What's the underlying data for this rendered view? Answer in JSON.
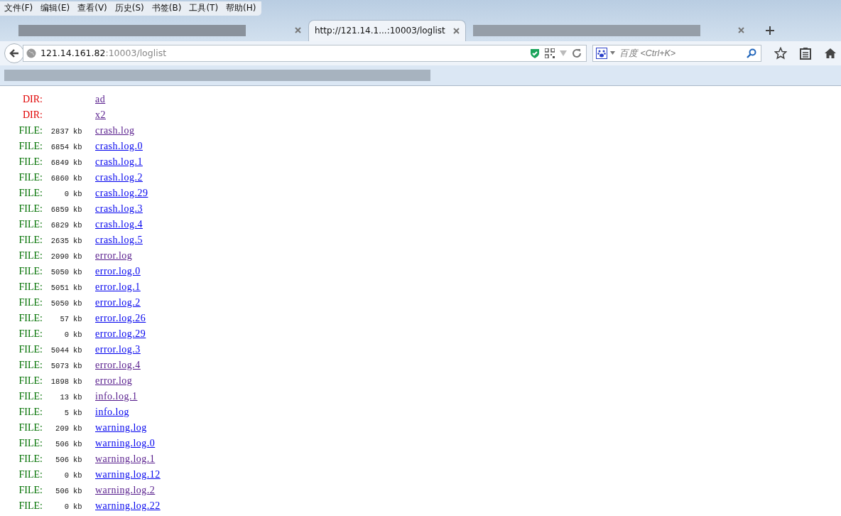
{
  "menu_bar": [
    "文件(F)",
    "编辑(E)",
    "查看(V)",
    "历史(S)",
    "书签(B)",
    "工具(T)",
    "帮助(H)"
  ],
  "tabs": [
    {
      "selected": false
    },
    {
      "title": "http://121.14.1...:10003/loglist",
      "selected": true
    },
    {
      "selected": false
    }
  ],
  "address_bar": {
    "host": "121.14.161.82",
    "path": ":10003/loglist"
  },
  "search": {
    "placeholder": "百度 <Ctrl+K>"
  },
  "listing": [
    {
      "kind": "dir",
      "label": "DIR:",
      "name": "ad",
      "visited": true
    },
    {
      "kind": "dir",
      "label": "DIR:",
      "name": "x2",
      "visited": true
    },
    {
      "kind": "file",
      "label": "FILE:",
      "size": "2837",
      "unit": "kb",
      "name": "crash.log",
      "visited": true
    },
    {
      "kind": "file",
      "label": "FILE:",
      "size": "6854",
      "unit": "kb",
      "name": "crash.log.0",
      "visited": false
    },
    {
      "kind": "file",
      "label": "FILE:",
      "size": "6849",
      "unit": "kb",
      "name": "crash.log.1",
      "visited": false
    },
    {
      "kind": "file",
      "label": "FILE:",
      "size": "6860",
      "unit": "kb",
      "name": "crash.log.2",
      "visited": false
    },
    {
      "kind": "file",
      "label": "FILE:",
      "size": "0",
      "unit": "kb",
      "name": "crash.log.29",
      "visited": false
    },
    {
      "kind": "file",
      "label": "FILE:",
      "size": "6859",
      "unit": "kb",
      "name": "crash.log.3",
      "visited": false
    },
    {
      "kind": "file",
      "label": "FILE:",
      "size": "6829",
      "unit": "kb",
      "name": "crash.log.4",
      "visited": false
    },
    {
      "kind": "file",
      "label": "FILE:",
      "size": "2635",
      "unit": "kb",
      "name": "crash.log.5",
      "visited": false
    },
    {
      "kind": "file",
      "label": "FILE:",
      "size": "2090",
      "unit": "kb",
      "name": "error.log",
      "visited": true
    },
    {
      "kind": "file",
      "label": "FILE:",
      "size": "5050",
      "unit": "kb",
      "name": "error.log.0",
      "visited": false
    },
    {
      "kind": "file",
      "label": "FILE:",
      "size": "5051",
      "unit": "kb",
      "name": "error.log.1",
      "visited": false
    },
    {
      "kind": "file",
      "label": "FILE:",
      "size": "5050",
      "unit": "kb",
      "name": "error.log.2",
      "visited": false
    },
    {
      "kind": "file",
      "label": "FILE:",
      "size": "57",
      "unit": "kb",
      "name": "error.log.26",
      "visited": false
    },
    {
      "kind": "file",
      "label": "FILE:",
      "size": "0",
      "unit": "kb",
      "name": "error.log.29",
      "visited": false
    },
    {
      "kind": "file",
      "label": "FILE:",
      "size": "5044",
      "unit": "kb",
      "name": "error.log.3",
      "visited": false
    },
    {
      "kind": "file",
      "label": "FILE:",
      "size": "5073",
      "unit": "kb",
      "name": "error.log.4",
      "visited": true
    },
    {
      "kind": "file",
      "label": "FILE:",
      "size": "1898",
      "unit": "kb",
      "name": "error.log",
      "visited": true
    },
    {
      "kind": "file",
      "label": "FILE:",
      "size": "13",
      "unit": "kb",
      "name": "info.log.1",
      "visited": true
    },
    {
      "kind": "file",
      "label": "FILE:",
      "size": "5",
      "unit": "kb",
      "name": "info.log",
      "visited": false
    },
    {
      "kind": "file",
      "label": "FILE:",
      "size": "209",
      "unit": "kb",
      "name": "warning.log",
      "visited": false
    },
    {
      "kind": "file",
      "label": "FILE:",
      "size": "506",
      "unit": "kb",
      "name": "warning.log.0",
      "visited": false
    },
    {
      "kind": "file",
      "label": "FILE:",
      "size": "506",
      "unit": "kb",
      "name": "warning.log.1",
      "visited": true
    },
    {
      "kind": "file",
      "label": "FILE:",
      "size": "0",
      "unit": "kb",
      "name": "warning.log.12",
      "visited": false
    },
    {
      "kind": "file",
      "label": "FILE:",
      "size": "506",
      "unit": "kb",
      "name": "warning.log.2",
      "visited": true
    },
    {
      "kind": "file",
      "label": "FILE:",
      "size": "0",
      "unit": "kb",
      "name": "warning.log.22",
      "visited": false
    }
  ]
}
